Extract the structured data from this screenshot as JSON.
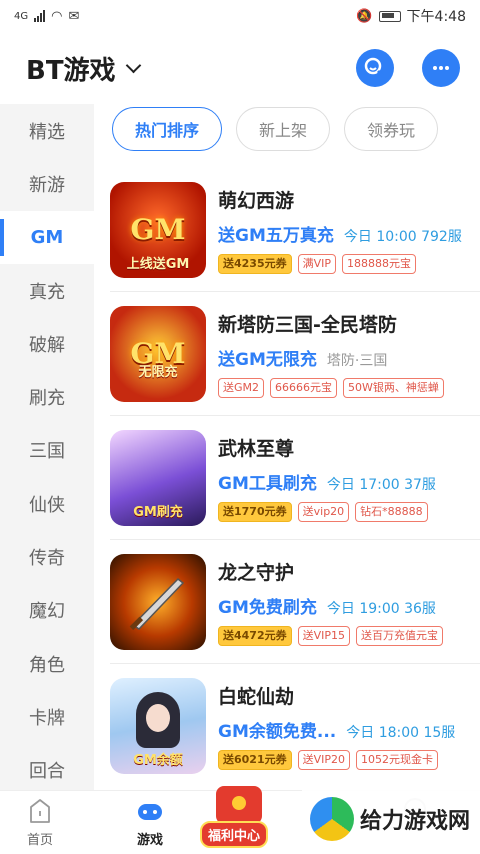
{
  "status": {
    "network": "4G",
    "time": "下午4:48"
  },
  "header": {
    "title": "BT游戏"
  },
  "sidebar": {
    "items": [
      "精选",
      "新游",
      "GM",
      "真充",
      "破解",
      "刷充",
      "三国",
      "仙侠",
      "传奇",
      "魔幻",
      "角色",
      "卡牌",
      "回合"
    ],
    "active": "GM"
  },
  "tabs": [
    "热门排序",
    "新上架",
    "领券玩"
  ],
  "games": [
    {
      "name": "萌幻西游",
      "tagline": "送GM五万真充",
      "extra": "今日 10:00 792服",
      "icon_text": "GM",
      "icon_ribbon": "上线送GM",
      "badges": [
        "送4235元券",
        "满VIP",
        "188888元宝"
      ]
    },
    {
      "name": "新塔防三国-全民塔防",
      "tagline": "送GM无限充",
      "extra": "塔防·三国",
      "icon_text": "GM",
      "icon_ribbon": "无限充",
      "badges": [
        "送GM2",
        "66666元宝",
        "50W银两、神惩蝉"
      ]
    },
    {
      "name": "武林至尊",
      "tagline": "GM工具刷充",
      "extra": "今日 17:00 37服",
      "icon_text": "",
      "icon_ribbon": "GM刷充",
      "badges": [
        "送1770元券",
        "送vip20",
        "钻石*88888"
      ]
    },
    {
      "name": "龙之守护",
      "tagline": "GM免费刷充",
      "extra": "今日 19:00 36服",
      "icon_text": "",
      "icon_ribbon": "",
      "badges": [
        "送4472元券",
        "送VIP15",
        "送百万充值元宝"
      ]
    },
    {
      "name": "白蛇仙劫",
      "tagline": "GM余额免费...",
      "extra": "今日 18:00 15服",
      "icon_text": "",
      "icon_ribbon": "GM余额",
      "badges": [
        "送6021元券",
        "送VIP20",
        "1052元现金卡"
      ]
    }
  ],
  "bottom_nav": {
    "home": "首页",
    "games": "游戏",
    "welfare": "福利中心"
  },
  "watermark": "给力游戏网",
  "colors": {
    "accent": "#2f7ff6",
    "coupon": "#ffc83d",
    "badge_red": "#e0574a"
  }
}
